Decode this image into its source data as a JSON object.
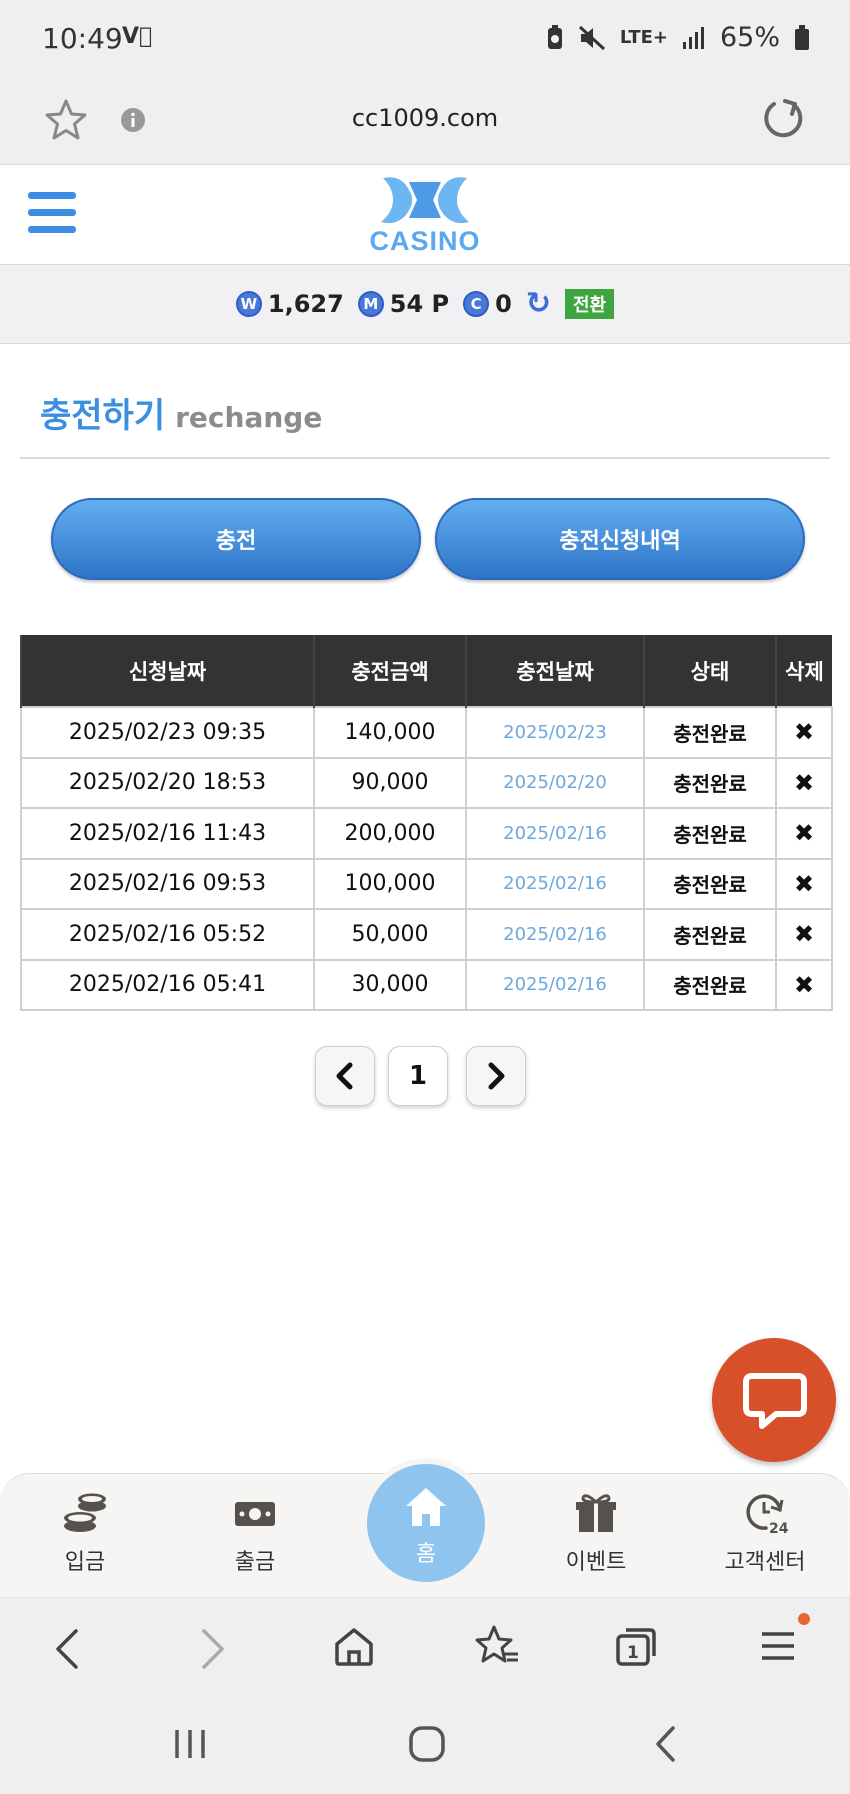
{
  "status_bar": {
    "time": "10:49",
    "right": "LTE+",
    "battery": "65%"
  },
  "browser": {
    "url": "cc1009.com"
  },
  "header": {
    "logo_text": "CASINO"
  },
  "balance": {
    "won": "1,627",
    "point": "54 P",
    "coin": "0",
    "switch_label": "전환",
    "won_symbol": "W",
    "point_symbol": "M",
    "coin_symbol": "C"
  },
  "page": {
    "title_ko": "충전하기",
    "title_en": "rechange"
  },
  "buttons": {
    "charge": "충전",
    "history": "충전신청내역"
  },
  "table": {
    "headers": [
      "신청날짜",
      "충전금액",
      "충전날짜",
      "상태",
      "삭제"
    ],
    "rows": [
      {
        "requested": "2025/02/23 09:35",
        "amount": "140,000",
        "charged": "2025/02/23",
        "status": "충전완료",
        "delete": "✖"
      },
      {
        "requested": "2025/02/20 18:53",
        "amount": "90,000",
        "charged": "2025/02/20",
        "status": "충전완료",
        "delete": "✖"
      },
      {
        "requested": "2025/02/16 11:43",
        "amount": "200,000",
        "charged": "2025/02/16",
        "status": "충전완료",
        "delete": "✖"
      },
      {
        "requested": "2025/02/16 09:53",
        "amount": "100,000",
        "charged": "2025/02/16",
        "status": "충전완료",
        "delete": "✖"
      },
      {
        "requested": "2025/02/16 05:52",
        "amount": "50,000",
        "charged": "2025/02/16",
        "status": "충전완료",
        "delete": "✖"
      },
      {
        "requested": "2025/02/16 05:41",
        "amount": "30,000",
        "charged": "2025/02/16",
        "status": "충전완료",
        "delete": "✖"
      }
    ]
  },
  "pagination": {
    "current": "1"
  },
  "bottom_nav": {
    "deposit": "입금",
    "withdraw": "출금",
    "home": "홈",
    "event": "이벤트",
    "support": "고객센터"
  }
}
